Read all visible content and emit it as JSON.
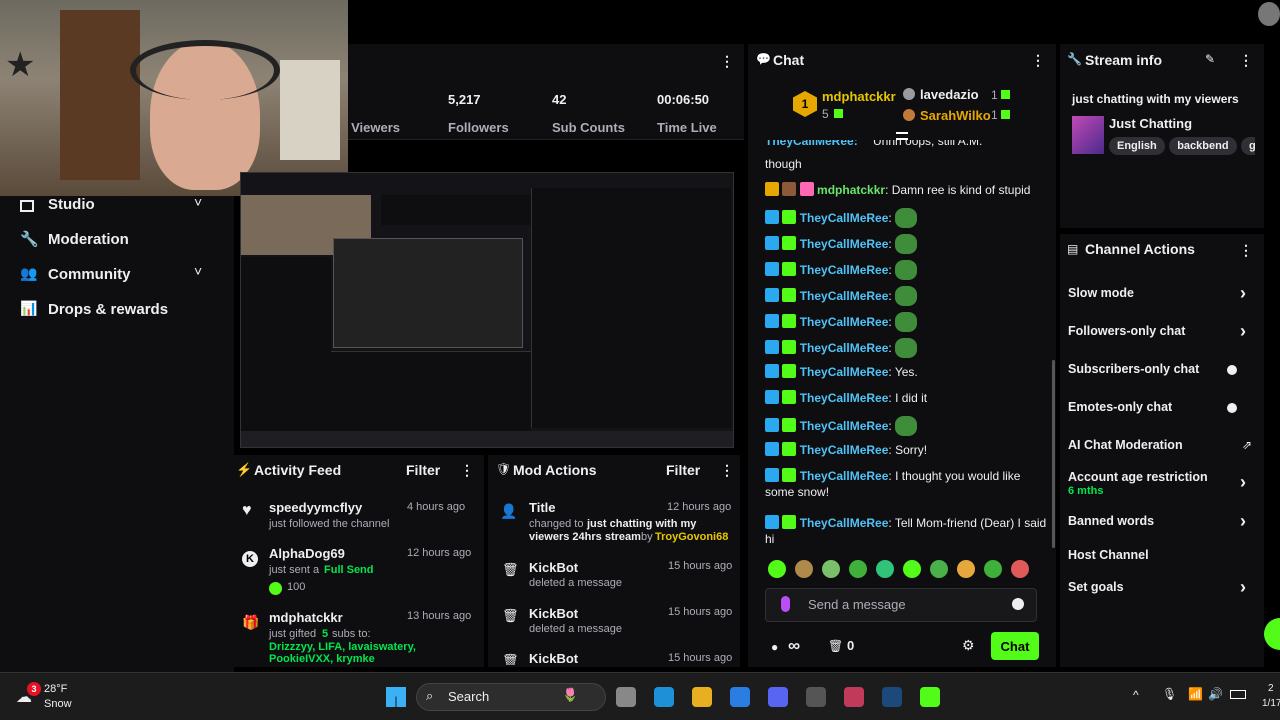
{
  "stats": {
    "viewers_label": "Viewers",
    "followers_value": "5,217",
    "followers_label": "Followers",
    "subs_value": "42",
    "subs_label": "Sub Counts",
    "time_value": "00:06:50",
    "time_label": "Time Live"
  },
  "sidebar": {
    "items": [
      {
        "label": "Studio",
        "icon": "studio-icon",
        "expand": true
      },
      {
        "label": "Moderation",
        "icon": "wrench-icon",
        "expand": false
      },
      {
        "label": "Community",
        "icon": "community-icon",
        "expand": true
      },
      {
        "label": "Drops & rewards",
        "icon": "drops-icon",
        "expand": false
      }
    ]
  },
  "activity_feed": {
    "title": "Activity Feed",
    "filter": "Filter",
    "items": [
      {
        "icon": "heart-icon",
        "name": "speedyymcflyy",
        "time": "4 hours ago",
        "desc": "just followed the channel"
      },
      {
        "icon": "kick-icon",
        "name": "AlphaDog69",
        "time": "12 hours ago",
        "desc": "just sent a",
        "highlight": "Full Send",
        "amount": "100"
      },
      {
        "icon": "gift-icon",
        "name": "mdphatckkr",
        "time": "13 hours ago",
        "desc": "just gifted",
        "count": "5",
        "desc2": "subs to:",
        "recipients": "Drizzzyy, LIFA, lavaiswatery, PookieIVXX, krymke"
      }
    ]
  },
  "mod_actions": {
    "title": "Mod Actions",
    "filter": "Filter",
    "items": [
      {
        "icon": "title-icon",
        "name": "Title",
        "time": "12 hours ago",
        "desc": "changed to",
        "value": "just chatting with my viewers 24hrs stream",
        "by": "by",
        "user": "TroyGovoni68"
      },
      {
        "icon": "trash-icon",
        "name": "KickBot",
        "time": "15 hours ago",
        "desc": "deleted a message"
      },
      {
        "icon": "trash-icon",
        "name": "KickBot",
        "time": "15 hours ago",
        "desc": "deleted a message"
      },
      {
        "icon": "trash-icon",
        "name": "KickBot",
        "time": "15 hours ago",
        "desc": ""
      }
    ]
  },
  "chat": {
    "title": "Chat",
    "leaders": [
      {
        "rank": "1",
        "name": "mdphatckkr",
        "count": "5"
      },
      {
        "name": "lavedazio",
        "count": "1"
      },
      {
        "name": "SarahWilko",
        "count": "1"
      }
    ],
    "partial_top": "though",
    "partial_top_text": "Uhhh oops, still A.M.",
    "messages": [
      {
        "user": "mdphatckkr",
        "color": "#67e66a",
        "text": "Damn ree is kind of stupid",
        "emote": false
      },
      {
        "user": "TheyCallMeRee",
        "color": "#4fc3f7",
        "text": "",
        "emote": true
      },
      {
        "user": "TheyCallMeRee",
        "color": "#4fc3f7",
        "text": "",
        "emote": true
      },
      {
        "user": "TheyCallMeRee",
        "color": "#4fc3f7",
        "text": "",
        "emote": true
      },
      {
        "user": "TheyCallMeRee",
        "color": "#4fc3f7",
        "text": "",
        "emote": true
      },
      {
        "user": "TheyCallMeRee",
        "color": "#4fc3f7",
        "text": "",
        "emote": true
      },
      {
        "user": "TheyCallMeRee",
        "color": "#4fc3f7",
        "text": "",
        "emote": true
      },
      {
        "user": "TheyCallMeRee",
        "color": "#4fc3f7",
        "text": "Yes.",
        "emote": false
      },
      {
        "user": "TheyCallMeRee",
        "color": "#4fc3f7",
        "text": "I did it",
        "emote": false
      },
      {
        "user": "TheyCallMeRee",
        "color": "#4fc3f7",
        "text": "",
        "emote": true
      },
      {
        "user": "TheyCallMeRee",
        "color": "#4fc3f7",
        "text": "Sorry!",
        "emote": false
      },
      {
        "user": "TheyCallMeRee",
        "color": "#4fc3f7",
        "text": "I thought you would like some snow!",
        "emote": false
      },
      {
        "user": "TheyCallMeRee",
        "color": "#4fc3f7",
        "text": "Tell Mom-friend (Dear) I said hi",
        "emote": false
      }
    ],
    "placeholder": "Send a message",
    "send_label": "Chat",
    "viewer_infinity": "∞",
    "trash_count": "0"
  },
  "stream_info": {
    "title": "Stream info",
    "stream_title": "just chatting with my viewers",
    "category": "Just Chatting",
    "tags": [
      "English",
      "backbend",
      "g"
    ]
  },
  "channel_actions": {
    "title": "Channel Actions",
    "items": [
      {
        "label": "Slow mode",
        "control": "chevron"
      },
      {
        "label": "Followers-only chat",
        "control": "chevron"
      },
      {
        "label": "Subscribers-only chat",
        "control": "toggle"
      },
      {
        "label": "Emotes-only chat",
        "control": "toggle"
      },
      {
        "label": "AI Chat Moderation",
        "control": "external"
      },
      {
        "label": "Account age restriction",
        "sub": "6 mths",
        "control": "chevron"
      },
      {
        "label": "Banned words",
        "control": "chevron"
      },
      {
        "label": "Host Channel",
        "control": "none"
      },
      {
        "label": "Set goals",
        "control": "chevron"
      }
    ]
  },
  "taskbar": {
    "temp": "28°F",
    "weather": "Snow",
    "weather_badge": "3",
    "search": "Search",
    "time": "2",
    "date": "1/17"
  },
  "colors": {
    "accent": "#53fc18",
    "bg": "#0e0e10",
    "panel": "#18181b"
  }
}
